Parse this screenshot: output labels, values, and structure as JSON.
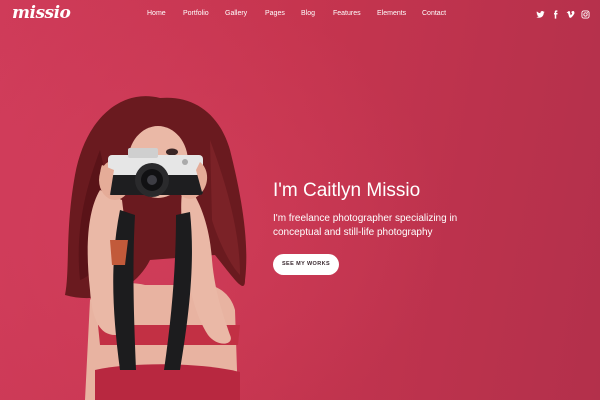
{
  "brand": {
    "logo_text": "missio"
  },
  "nav": {
    "items": [
      {
        "label": "Home"
      },
      {
        "label": "Portfolio"
      },
      {
        "label": "Gallery"
      },
      {
        "label": "Pages"
      },
      {
        "label": "Blog"
      },
      {
        "label": "Features"
      },
      {
        "label": "Elements"
      },
      {
        "label": "Contact"
      }
    ]
  },
  "social": [
    {
      "icon": "twitter-icon"
    },
    {
      "icon": "facebook-icon"
    },
    {
      "icon": "vimeo-icon"
    },
    {
      "icon": "instagram-icon"
    }
  ],
  "hero": {
    "title": "I'm Caitlyn Missio",
    "subtitle_line1": "I'm freelance photographer specializing in",
    "subtitle_line2": "conceptual and still-life photography",
    "cta_label": "SEE MY WORKS"
  },
  "colors": {
    "background": "#c4334f",
    "text": "#ffffff",
    "button_bg": "#ffffff",
    "button_text": "#3a2a30"
  }
}
